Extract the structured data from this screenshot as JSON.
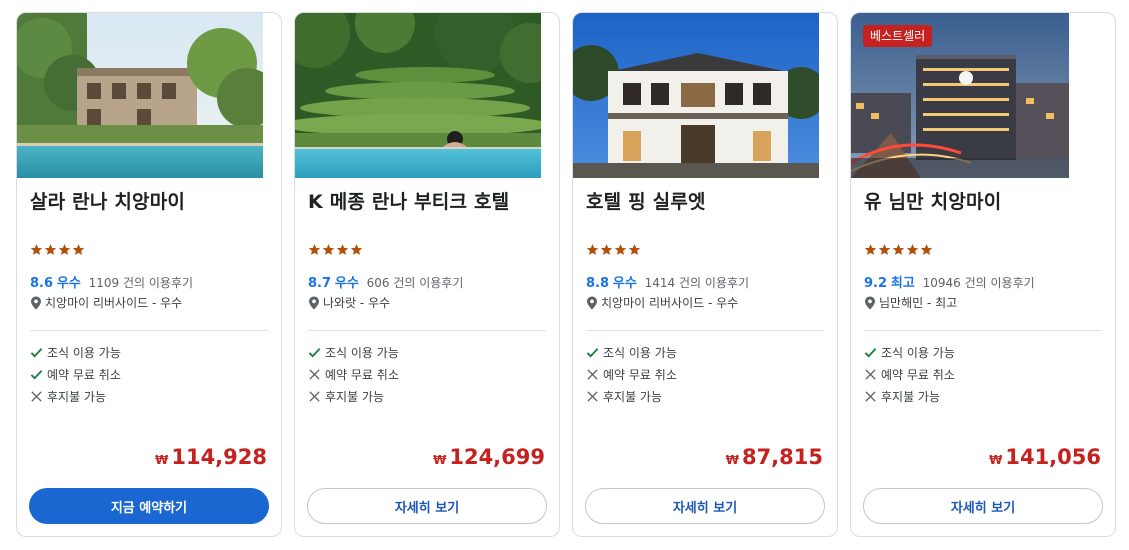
{
  "cards": [
    {
      "name": "살라 란나 치앙마이",
      "stars": 4,
      "score": "8.6",
      "score_label": "우수",
      "reviews": "1109 건의 이용후기",
      "location": "치앙마이 리버사이드 - 우수",
      "amenities": [
        {
          "text": "조식 이용 가능",
          "available": true
        },
        {
          "text": "예약 무료 취소",
          "available": true
        },
        {
          "text": "후지불 가능",
          "available": false
        }
      ],
      "currency": "₩",
      "price": "114,928",
      "button": "지금 예약하기",
      "badge": ""
    },
    {
      "name": "K 메종 란나 부티크 호텔",
      "stars": 4,
      "score": "8.7",
      "score_label": "우수",
      "reviews": "606 건의 이용후기",
      "location": "나와랏 - 우수",
      "amenities": [
        {
          "text": "조식 이용 가능",
          "available": true
        },
        {
          "text": "예약 무료 취소",
          "available": false
        },
        {
          "text": "후지불 가능",
          "available": false
        }
      ],
      "currency": "₩",
      "price": "124,699",
      "button": "자세히 보기",
      "badge": ""
    },
    {
      "name": "호텔 핑 실루엣",
      "stars": 4,
      "score": "8.8",
      "score_label": "우수",
      "reviews": "1414 건의 이용후기",
      "location": "치앙마이 리버사이드 - 우수",
      "amenities": [
        {
          "text": "조식 이용 가능",
          "available": true
        },
        {
          "text": "예약 무료 취소",
          "available": false
        },
        {
          "text": "후지불 가능",
          "available": false
        }
      ],
      "currency": "₩",
      "price": "87,815",
      "button": "자세히 보기",
      "badge": ""
    },
    {
      "name": "유 님만 치앙마이",
      "stars": 5,
      "score": "9.2",
      "score_label": "최고",
      "reviews": "10946 건의 이용후기",
      "location": "님만해민 - 최고",
      "amenities": [
        {
          "text": "조식 이용 가능",
          "available": true
        },
        {
          "text": "예약 무료 취소",
          "available": false
        },
        {
          "text": "후지불 가능",
          "available": false
        }
      ],
      "currency": "₩",
      "price": "141,056",
      "button": "자세히 보기",
      "badge": "베스트셀러"
    }
  ],
  "colors": {
    "price": "#c5221f",
    "rating": "#1a73e8",
    "star": "#b4500b",
    "check": "#188038",
    "primary_button": "#1a67d2",
    "badge": "#c5221f"
  }
}
